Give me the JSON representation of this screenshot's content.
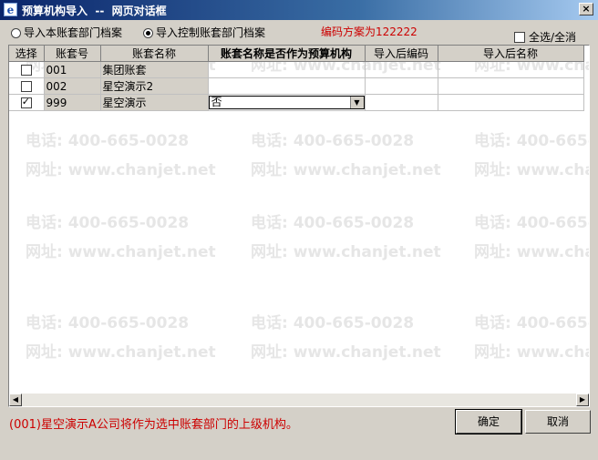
{
  "window": {
    "title": "预算机构导入  --  网页对话框",
    "close_label": "×"
  },
  "options": {
    "radio_local": "导入本账套部门档案",
    "radio_control": "导入控制账套部门档案",
    "code_scheme": "编码方案为122222",
    "select_all": "全选/全消"
  },
  "table": {
    "headers": [
      "选择",
      "账套号",
      "账套名称",
      "账套名称是否作为预算机构",
      "导入后编码",
      "导入后名称"
    ],
    "rows": [
      {
        "checked": false,
        "code": "001",
        "name": "集团账套",
        "as_org": "",
        "new_code": "",
        "new_name": ""
      },
      {
        "checked": false,
        "code": "002",
        "name": "星空演示2",
        "as_org": "",
        "new_code": "",
        "new_name": ""
      },
      {
        "checked": true,
        "code": "999",
        "name": "星空演示",
        "as_org": "否",
        "new_code": "",
        "new_name": ""
      }
    ]
  },
  "watermark": {
    "phone": "电话: 400-665-0028",
    "site": "网址: www.chanjet.net"
  },
  "status": {
    "message": "(001)星空演示A公司将作为选中账套部门的上级机构。"
  },
  "buttons": {
    "ok": "确定",
    "cancel": "取消"
  }
}
